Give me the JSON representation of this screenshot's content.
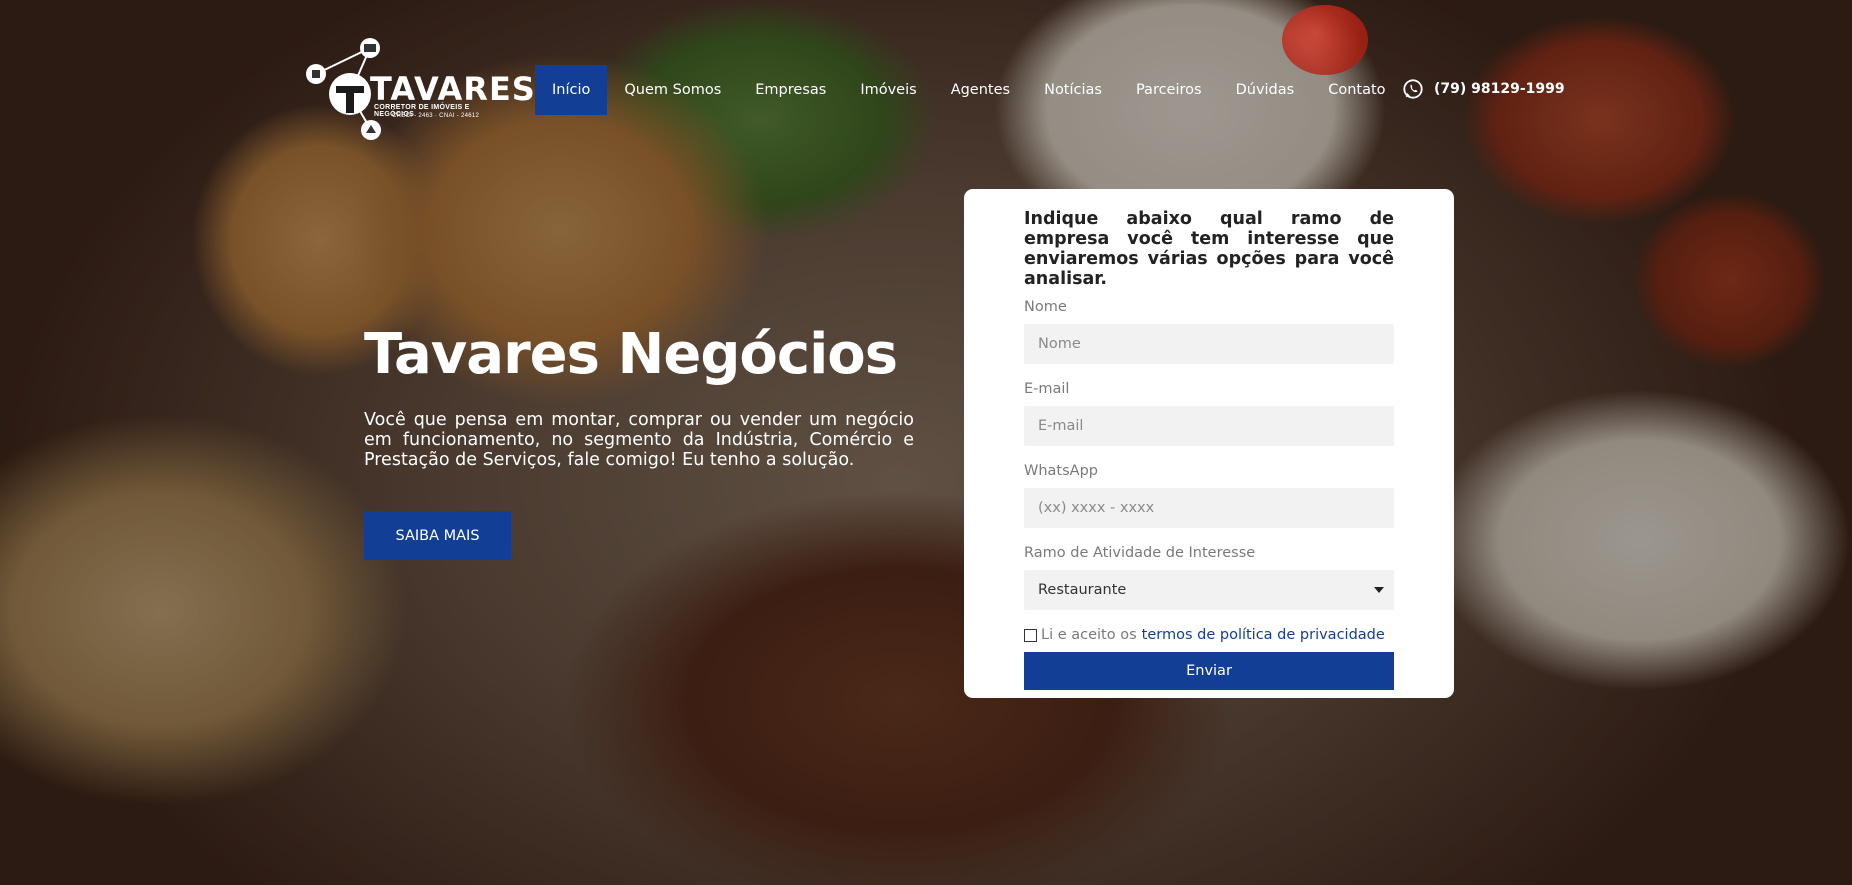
{
  "header": {
    "logo": {
      "brand": "TAVARES",
      "tagline": "CORRETOR DE IMÓVEIS E NEGÓCIOS",
      "registry": "CRECI - 2463  ·  CNAI - 24612"
    },
    "nav": [
      {
        "label": "Início",
        "active": true
      },
      {
        "label": "Quem Somos"
      },
      {
        "label": "Empresas"
      },
      {
        "label": "Imóveis"
      },
      {
        "label": "Agentes"
      },
      {
        "label": "Notícias"
      },
      {
        "label": "Parceiros"
      },
      {
        "label": "Dúvidas"
      },
      {
        "label": "Contato"
      }
    ],
    "phone": "(79) 98129-1999",
    "phone_icon": "whatsapp-icon"
  },
  "hero": {
    "title": "Tavares Negócios",
    "text": "Você que pensa em montar, comprar ou vender um negócio em funcionamento, no segmento da Indústria, Comércio e Prestação de Serviços, fale comigo! Eu tenho a solução.",
    "button": "SAIBA MAIS"
  },
  "form": {
    "heading": "Indique abaixo qual ramo de empresa você tem interesse que enviaremos várias opções para você analisar.",
    "name_label": "Nome",
    "name_placeholder": "Nome",
    "email_label": "E-mail",
    "email_placeholder": "E-mail",
    "whatsapp_label": "WhatsApp",
    "whatsapp_placeholder": "(xx) xxxx - xxxx",
    "activity_label": "Ramo de Atividade de Interesse",
    "activity_selected": "Restaurante",
    "privacy_text": "Li e aceito os",
    "privacy_link": "termos de política de privacidade",
    "submit": "Enviar"
  },
  "colors": {
    "primary": "#123f95",
    "card": "#ffffff",
    "input_bg": "#f2f2f2"
  }
}
